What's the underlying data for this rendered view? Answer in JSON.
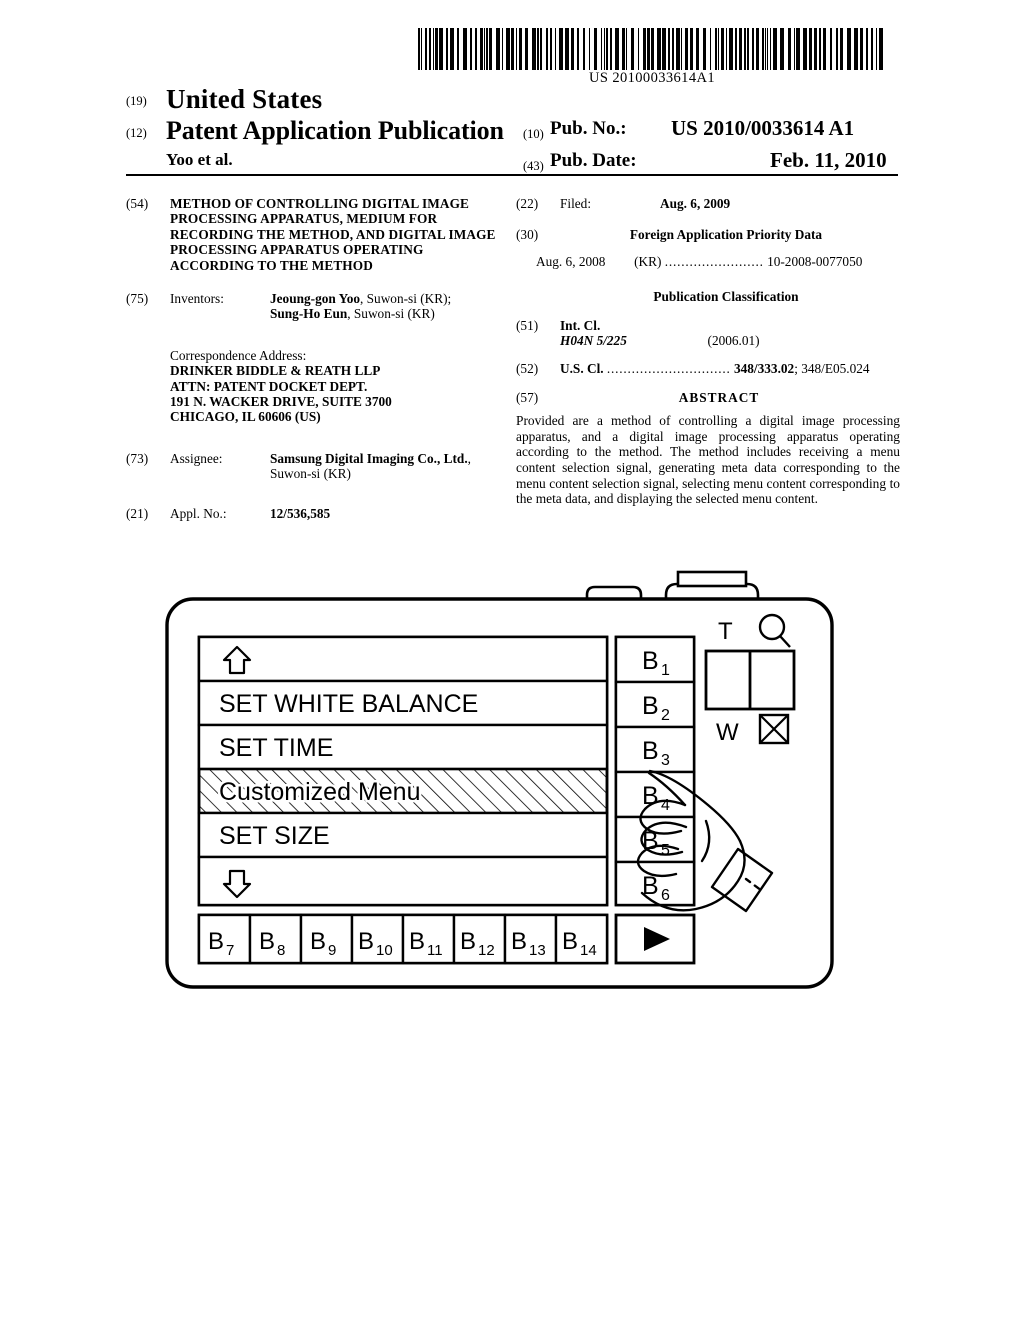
{
  "document": {
    "barcode_text": "US 20100033614A1",
    "country_code_num": "(19)",
    "country": "United States",
    "doc_type_num": "(12)",
    "doc_type": "Patent Application Publication",
    "authors": "Yoo et al.",
    "pubno_num": "(10)",
    "pubno_label": "Pub. No.:",
    "pubno_value": "US 2010/0033614 A1",
    "pubdate_num": "(43)",
    "pubdate_label": "Pub. Date:",
    "pubdate_value": "Feb. 11, 2010"
  },
  "left_column": {
    "title_num": "(54)",
    "title": "METHOD OF CONTROLLING DIGITAL IMAGE PROCESSING APPARATUS, MEDIUM FOR RECORDING THE METHOD, AND DIGITAL IMAGE PROCESSING APPARATUS OPERATING ACCORDING TO THE METHOD",
    "inventors_num": "(75)",
    "inventors_label": "Inventors:",
    "inventor_1_name": "Jeoung-gon Yoo",
    "inventor_1_loc": ", Suwon-si (KR);",
    "inventor_2_name": "Sung-Ho Eun",
    "inventor_2_loc": ", Suwon-si (KR)",
    "correspondence_label": "Correspondence Address:",
    "correspondence_lines": [
      "DRINKER BIDDLE & REATH LLP",
      "ATTN: PATENT DOCKET DEPT.",
      "191 N. WACKER DRIVE, SUITE 3700",
      "CHICAGO, IL 60606 (US)"
    ],
    "assignee_num": "(73)",
    "assignee_label": "Assignee:",
    "assignee_name": "Samsung Digital Imaging Co., Ltd.",
    "assignee_loc": ", Suwon-si (KR)",
    "applno_num": "(21)",
    "applno_label": "Appl. No.:",
    "applno_value": "12/536,585"
  },
  "right_column": {
    "filed_num": "(22)",
    "filed_label": "Filed:",
    "filed_value": "Aug. 6, 2009",
    "foreign_num": "(30)",
    "foreign_head": "Foreign Application Priority Data",
    "priority_date": "Aug. 6, 2008",
    "priority_country": "(KR)",
    "priority_dots": "........................",
    "priority_number": "10-2008-0077050",
    "pubclass_head": "Publication Classification",
    "intcl_num": "(51)",
    "intcl_label": "Int. Cl.",
    "intcl_code": "H04N 5/225",
    "intcl_version": "(2006.01)",
    "uscl_num": "(52)",
    "uscl_label": "U.S. Cl.",
    "uscl_dots": "..............................",
    "uscl_primary": "348/333.02",
    "uscl_secondary": "; 348/E05.024",
    "abstract_num": "(57)",
    "abstract_head": "ABSTRACT",
    "abstract_text": "Provided are a method of controlling a digital image processing apparatus, and a digital image processing apparatus operating according to the method. The method includes receiving a menu content selection signal, generating meta data corresponding to the menu content selection signal, selecting menu content corresponding to the meta data, and displaying the selected menu content."
  },
  "figure": {
    "menu_rows": [
      {
        "label": "",
        "icon": "up-arrow-icon",
        "highlighted": false
      },
      {
        "label": "SET WHITE BALANCE",
        "icon": "",
        "highlighted": false
      },
      {
        "label": "SET TIME",
        "icon": "",
        "highlighted": false
      },
      {
        "label": "Customized Menu",
        "icon": "",
        "highlighted": true
      },
      {
        "label": "SET SIZE",
        "icon": "",
        "highlighted": false
      },
      {
        "label": "",
        "icon": "down-arrow-icon",
        "highlighted": false
      }
    ],
    "side_buttons": [
      {
        "base": "B",
        "sub": "1"
      },
      {
        "base": "B",
        "sub": "2"
      },
      {
        "base": "B",
        "sub": "3"
      },
      {
        "base": "B",
        "sub": "4"
      },
      {
        "base": "B",
        "sub": "5"
      },
      {
        "base": "B",
        "sub": "6"
      }
    ],
    "bottom_buttons": [
      {
        "base": "B",
        "sub": "7"
      },
      {
        "base": "B",
        "sub": "8"
      },
      {
        "base": "B",
        "sub": "9"
      },
      {
        "base": "B",
        "sub": "10"
      },
      {
        "base": "B",
        "sub": "11"
      },
      {
        "base": "B",
        "sub": "12"
      },
      {
        "base": "B",
        "sub": "13"
      },
      {
        "base": "B",
        "sub": "14"
      }
    ],
    "zoom_tele_label": "T",
    "zoom_wide_label": "W",
    "play_button_icon": "play-triangle-icon",
    "magnifier_icon": "magnifier-icon",
    "delete_icon": "crossed-box-icon"
  }
}
